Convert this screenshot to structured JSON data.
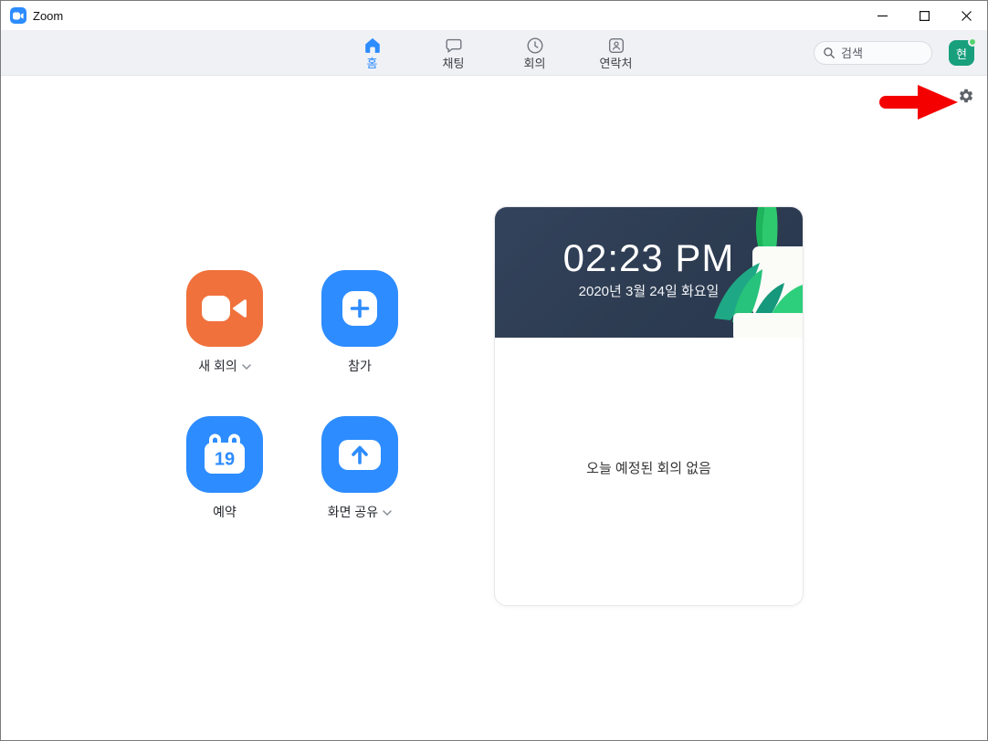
{
  "window": {
    "title": "Zoom",
    "controls": {
      "minimize": "minimize",
      "maximize": "maximize",
      "close": "close"
    }
  },
  "navbar": {
    "tabs": [
      {
        "label": "홈",
        "icon": "home-icon",
        "active": true
      },
      {
        "label": "채팅",
        "icon": "chat-icon",
        "active": false
      },
      {
        "label": "회의",
        "icon": "meetings-icon",
        "active": false
      },
      {
        "label": "연락처",
        "icon": "contacts-icon",
        "active": false
      }
    ],
    "search": {
      "placeholder": "검색"
    },
    "avatar": {
      "initial": "현"
    }
  },
  "main": {
    "actions": [
      {
        "label": "새 회의",
        "icon": "video-camera-icon",
        "tile_color": "#f0713c",
        "has_dropdown": true
      },
      {
        "label": "참가",
        "icon": "plus-icon",
        "tile_color": "#2d8cff",
        "has_dropdown": false
      },
      {
        "label": "예약",
        "icon": "calendar-icon",
        "tile_color": "#2d8cff",
        "has_dropdown": false,
        "calendar_day": "19"
      },
      {
        "label": "화면 공유",
        "icon": "share-screen-icon",
        "tile_color": "#2d8cff",
        "has_dropdown": true
      }
    ],
    "meetings_card": {
      "time": "02:23 PM",
      "date": "2020년 3월 24일 화요일",
      "empty_message": "오늘 예정된 회의 없음"
    },
    "annotation": {
      "type": "red-arrow-pointing-to-settings",
      "color": "#f40000"
    }
  },
  "colors": {
    "accent_blue": "#2d8cff",
    "accent_orange": "#f0713c",
    "navbar_bg": "#f0f1f5",
    "card_header": "#2e3d52",
    "avatar_bg": "#18a07c",
    "presence_green": "#55d36e"
  }
}
